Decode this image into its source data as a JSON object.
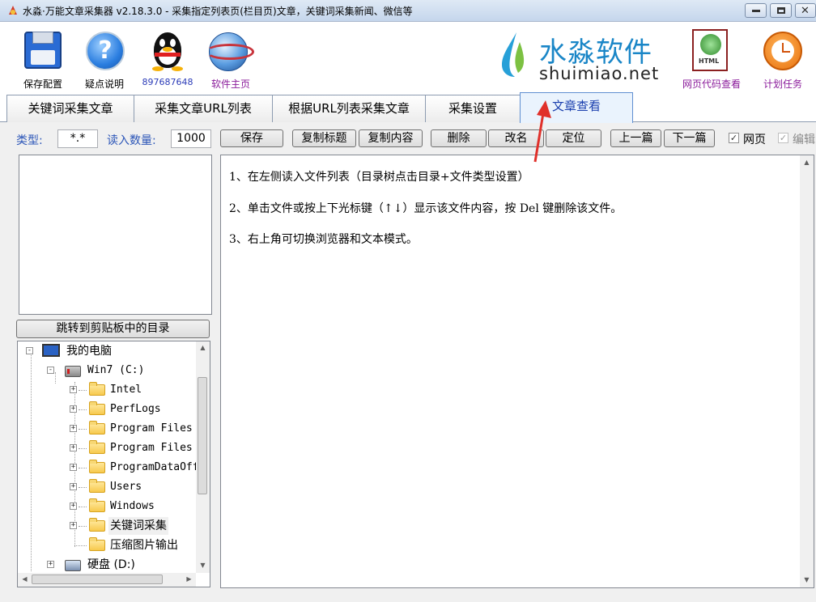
{
  "window": {
    "title": "水淼·万能文章采集器 v2.18.3.0 - 采集指定列表页(栏目页)文章，关键词采集新闻、微信等",
    "minimize": "",
    "maximize": "",
    "close": "✕"
  },
  "toolbar": {
    "save_config": "保存配置",
    "help": "疑点说明",
    "qq_number": "897687648",
    "homepage": "软件主页",
    "logo_cn": "水淼软件",
    "logo_en": "shuimiao.net",
    "html_viewer": "网页代码查看",
    "schedule": "计划任务",
    "html_tag": "HTML"
  },
  "tabs": [
    {
      "label": "关键词采集文章"
    },
    {
      "label": "采集文章URL列表"
    },
    {
      "label": "根据URL列表采集文章"
    },
    {
      "label": "采集设置"
    },
    {
      "label": "文章查看",
      "active": true
    }
  ],
  "controls": {
    "type_label": "类型:",
    "type_value": "*.*",
    "count_label": "读入数量:",
    "count_value": "1000",
    "save": "保存",
    "copy_title": "复制标题",
    "copy_content": "复制内容",
    "delete": "删除",
    "rename": "改名",
    "locate": "定位",
    "prev": "上一篇",
    "next": "下一篇",
    "webpage_label": "网页",
    "webpage_checked": "✓",
    "edit_label": "编辑",
    "edit_checked": "✓"
  },
  "left": {
    "jump_button": "跳转到剪贴板中的目录",
    "tree": {
      "computer": "我的电脑",
      "drive_c": "Win7 (C:)",
      "folders": [
        "Intel",
        "PerfLogs",
        "Program Files",
        "Program Files",
        "ProgramDataOff",
        "Users",
        "Windows",
        "关键词采集",
        "压缩图片输出"
      ],
      "drive_d": "硬盘 (D:)"
    }
  },
  "content": {
    "lines": [
      "1、在左侧读入文件列表（目录树点击目录+文件类型设置）",
      "2、单击文件或按上下光标键（↑↓）显示该文件内容，按 Del 键删除该文件。",
      "3、右上角可切换浏览器和文本模式。"
    ]
  },
  "colors": {
    "accent": "#2c56b8",
    "logo_blue": "#1a86c7",
    "arrow_red": "#e0302a",
    "active_tab": "#eaf3fd"
  }
}
